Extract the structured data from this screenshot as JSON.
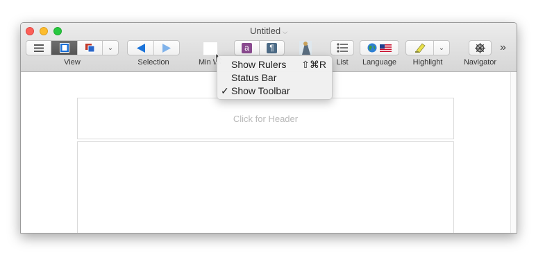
{
  "window": {
    "title": "Untitled"
  },
  "toolbar": {
    "view_label": "View",
    "selection_label": "Selection",
    "minwidth_label": "Min W",
    "list_label": "List",
    "language_label": "Language",
    "highlight_label": "Highlight",
    "navigator_label": "Navigator",
    "overflow_label": "»"
  },
  "menu": {
    "items": [
      {
        "label": "Show Rulers",
        "shortcut": "⇧⌘R",
        "checked": false
      },
      {
        "label": "Status Bar",
        "shortcut": "",
        "checked": false
      },
      {
        "label": "Show Toolbar",
        "shortcut": "",
        "checked": true
      }
    ]
  },
  "document": {
    "header_placeholder": "Click for Header"
  },
  "colors": {
    "accent": "#1a73d9",
    "close": "#fc5f57",
    "minimize": "#fdbc2e",
    "maximize": "#28c840"
  }
}
